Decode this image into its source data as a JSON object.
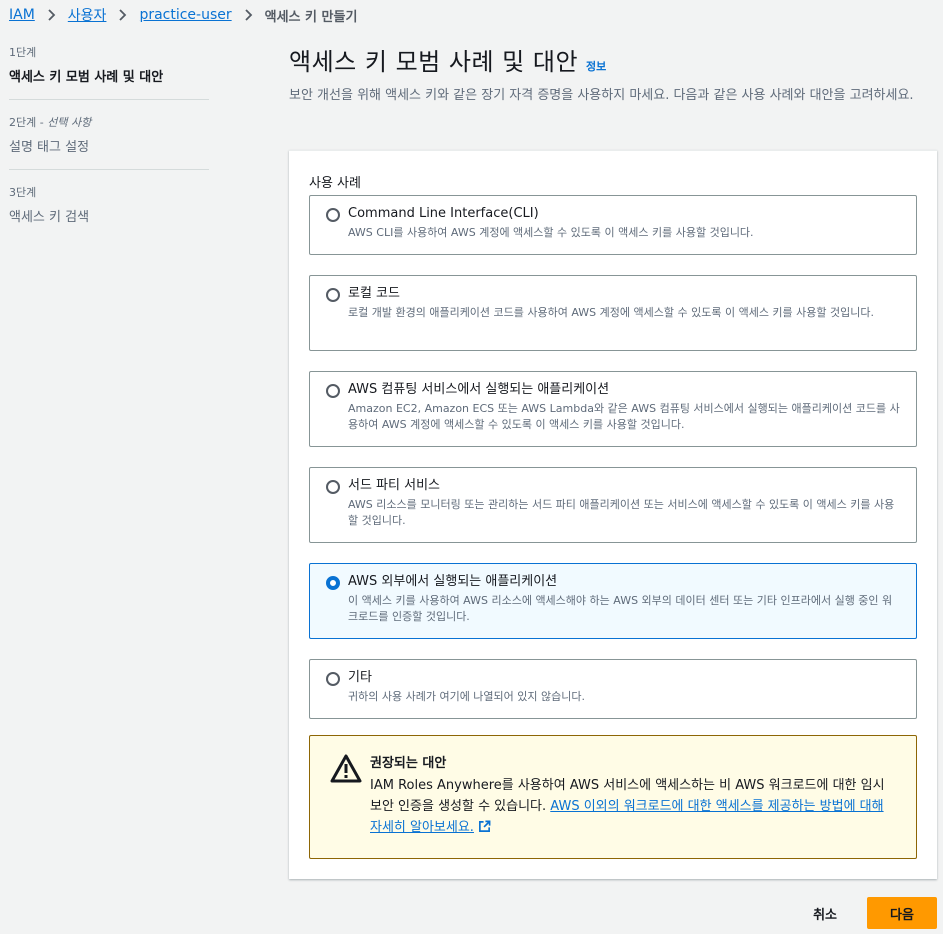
{
  "breadcrumb": {
    "items": [
      "IAM",
      "사용자",
      "practice-user"
    ],
    "current": "액세스 키 만들기"
  },
  "steps": [
    {
      "num": "1단계",
      "title": "액세스 키 모범 사례 및 대안"
    },
    {
      "num": "2단계",
      "num_suffix": "선택 사항",
      "title": "설명 태그 설정"
    },
    {
      "num": "3단계",
      "title": "액세스 키 검색"
    }
  ],
  "header": {
    "title": "액세스 키 모범 사례 및 대안",
    "info": "정보",
    "description": "보안 개선을 위해 액세스 키와 같은 장기 자격 증명을 사용하지 마세요. 다음과 같은 사용 사례와 대안을 고려하세요."
  },
  "usecase": {
    "label": "사용 사례",
    "options": [
      {
        "title": "Command Line Interface(CLI)",
        "desc": "AWS CLI를 사용하여 AWS 계정에 액세스할 수 있도록 이 액세스 키를 사용할 것입니다.",
        "selected": false
      },
      {
        "title": "로컬 코드",
        "desc": "로컬 개발 환경의 애플리케이션 코드를 사용하여 AWS 계정에 액세스할 수 있도록 이 액세스 키를 사용할 것입니다.",
        "selected": false
      },
      {
        "title": "AWS 컴퓨팅 서비스에서 실행되는 애플리케이션",
        "desc": "Amazon EC2, Amazon ECS 또는 AWS Lambda와 같은 AWS 컴퓨팅 서비스에서 실행되는 애플리케이션 코드를 사용하여 AWS 계정에 액세스할 수 있도록 이 액세스 키를 사용할 것입니다.",
        "selected": false
      },
      {
        "title": "서드 파티 서비스",
        "desc": "AWS 리소스를 모니터링 또는 관리하는 서드 파티 애플리케이션 또는 서비스에 액세스할 수 있도록 이 액세스 키를 사용할 것입니다.",
        "selected": false
      },
      {
        "title": "AWS 외부에서 실행되는 애플리케이션",
        "desc": "이 액세스 키를 사용하여 AWS 리소스에 액세스해야 하는 AWS 외부의 데이터 센터 또는 기타 인프라에서 실행 중인 워크로드를 인증할 것입니다.",
        "selected": true
      },
      {
        "title": "기타",
        "desc": "귀하의 사용 사례가 여기에 나열되어 있지 않습니다.",
        "selected": false
      }
    ]
  },
  "alert": {
    "title": "권장되는 대안",
    "body": "IAM Roles Anywhere를 사용하여 AWS 서비스에 액세스하는 비 AWS 워크로드에 대한 임시 보안 인증을 생성할 수 있습니다. ",
    "link": "AWS 이외의 워크로드에 대한 액세스를 제공하는 방법에 대해 자세히 알아보세요."
  },
  "footer": {
    "cancel": "취소",
    "next": "다음"
  },
  "colors": {
    "accent": "#0972d3",
    "primary_button": "#ff9900",
    "alert_bg": "#fffce6"
  }
}
